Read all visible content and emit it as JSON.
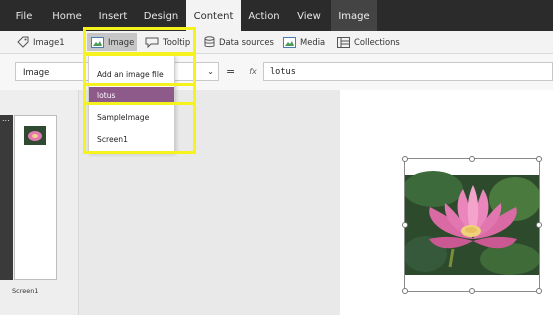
{
  "menubar": {
    "tabs": [
      {
        "label": "File"
      },
      {
        "label": "Home"
      },
      {
        "label": "Insert"
      },
      {
        "label": "Design"
      },
      {
        "label": "Content"
      },
      {
        "label": "Action"
      },
      {
        "label": "View"
      },
      {
        "label": "Image"
      }
    ],
    "active_tab": "Content",
    "context_tab": "Image"
  },
  "toolbar": {
    "image1_label": "Image1",
    "image_label": "Image",
    "tooltip_label": "Tooltip",
    "datasources_label": "Data sources",
    "media_label": "Media",
    "collections_label": "Collections"
  },
  "formula": {
    "property": "Image",
    "equals": "=",
    "fx": "fx",
    "value": "lotus"
  },
  "image_menu": {
    "items": [
      {
        "label": "Add an image file"
      },
      {
        "label": "lotus",
        "selected": true
      },
      {
        "label": "SampleImage"
      },
      {
        "label": "Screen1"
      }
    ]
  },
  "screens": {
    "thumb_label": "Screen1",
    "thumb_menu": "..."
  },
  "colors": {
    "ribbon_dark": "#2b2b2b",
    "selected_item": "#8e5a8a",
    "highlight": "#f6f21d"
  }
}
